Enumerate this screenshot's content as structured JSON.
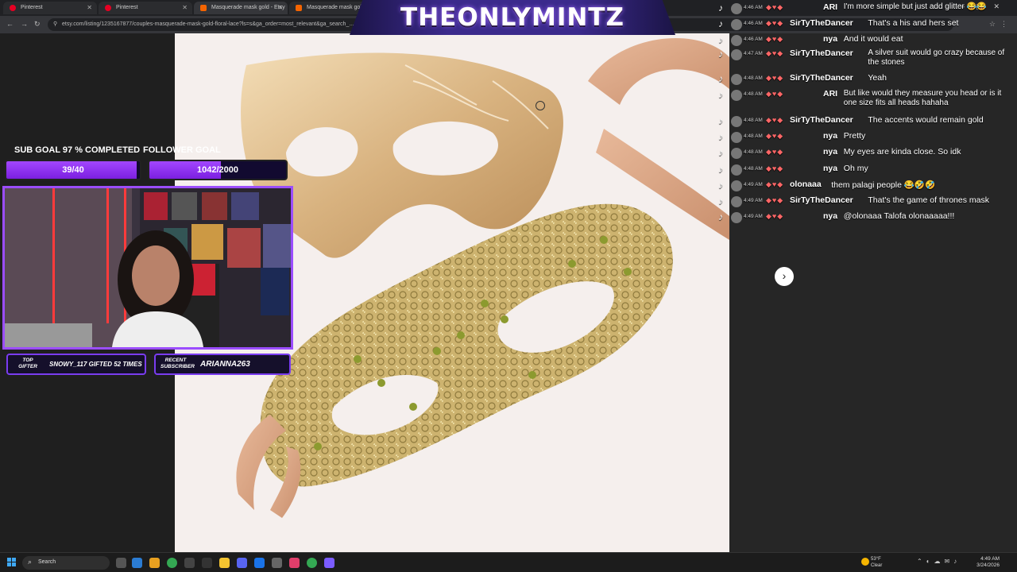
{
  "browser": {
    "tabs": [
      {
        "title": "Pinterest",
        "icon": "pinterest-icon"
      },
      {
        "title": "Pinterest",
        "icon": "pinterest-icon"
      },
      {
        "title": "Masquerade mask gold - Etsy",
        "icon": "etsy-icon"
      },
      {
        "title": "Masquerade mask gol",
        "icon": "etsy-icon"
      }
    ],
    "url": "etsy.com/listing/1235167877/couples-masquerade-mask-gold-floral-lace?ls=s&ga_order=most_relevant&ga_search_..."
  },
  "stream": {
    "title": "THEONLYMINTZ",
    "sub_goal_label": "SUB GOAL 97 % COMPLETED",
    "sub_goal_value": "39/40",
    "sub_goal_fraction": 0.975,
    "follower_goal_label": "FOLLOWER GOAL",
    "follower_goal_value": "1042/2000",
    "follower_goal_fraction": 0.521,
    "top_gifter_label": "TOP GIFTER",
    "top_gifter_value": "SNOWY_117 GIFTED 52 TIMES",
    "recent_sub_label": "RECENT SUBSCRIBER",
    "recent_sub_value": "ARIANNA263",
    "accent_color": "#9b4dff"
  },
  "chat": [
    {
      "time": "4:46 AM",
      "user": "ARI",
      "msg": "I'm more simple but just add glitter 😂😂"
    },
    {
      "time": "4:46 AM",
      "user": "SirTyTheDancer",
      "msg": "That's a his and hers set"
    },
    {
      "time": "4:46 AM",
      "user": "nya",
      "msg": "And it would eat"
    },
    {
      "time": "4:47 AM",
      "user": "SirTyTheDancer",
      "msg": "A silver suit would go crazy because of the stones"
    },
    {
      "time": "4:48 AM",
      "user": "SirTyTheDancer",
      "msg": "Yeah"
    },
    {
      "time": "4:48 AM",
      "user": "ARI",
      "msg": "But like would they measure you head or is it one size fits all heads hahaha"
    },
    {
      "time": "4:48 AM",
      "user": "SirTyTheDancer",
      "msg": "The accents would remain gold"
    },
    {
      "time": "4:48 AM",
      "user": "nya",
      "msg": "Pretty"
    },
    {
      "time": "4:48 AM",
      "user": "nya",
      "msg": "My eyes are kinda close. So idk"
    },
    {
      "time": "4:48 AM",
      "user": "nya",
      "msg": "Oh my"
    },
    {
      "time": "4:49 AM",
      "user": "olonaaa",
      "msg": "them palagi people 😂🤣🤣"
    },
    {
      "time": "4:49 AM",
      "user": "SirTyTheDancer",
      "msg": "That's the game of thrones mask"
    },
    {
      "time": "4:49 AM",
      "user": "nya",
      "msg": "@olonaaa Talofa olonaaaaa!!!"
    }
  ],
  "taskbar": {
    "search_placeholder": "Search",
    "weather_temp": "53°F",
    "weather_desc": "Clear",
    "time": "4:49 AM",
    "date": "3/24/2026"
  }
}
